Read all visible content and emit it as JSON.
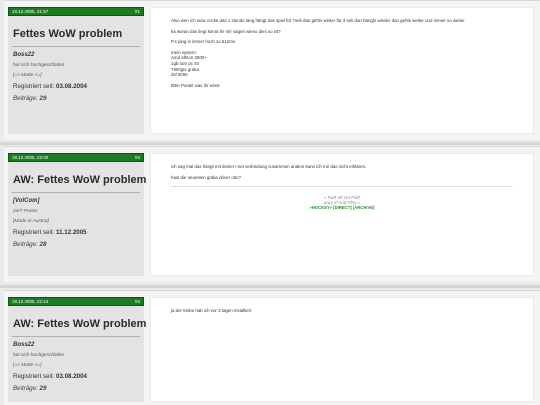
{
  "posts": [
    {
      "date": "19.12.2005, 21:57",
      "number": "#1",
      "title": "Fettes WoW problem",
      "user": "Boss22",
      "user_title": "hat sich hochgeschlafen",
      "extra": "[=> Müde <=]",
      "since_label": "Registriert seit:",
      "since_date": "03.08.2004",
      "count_label": "Beiträge:",
      "count": "29",
      "body": [
        "Also wen ich wow zocke das 1 stunde lang hängt das spiel für 7sek dan gehts weiter für 3 sek dan hängts wieder dan gehts weiter und immer so weiter",
        "ka woran das liegt könnt ihr mir sagen wieso dies so ist?",
        "P.s ping is immer hoch so 612ms",
        "mein system:",
        "Amd athlon 3500+",
        "1gb ram pc 40",
        "7800gtx graka",
        "dsl 6000",
        "Bitte Postet was ihr wisst"
      ]
    },
    {
      "date": "19.12.2005, 22:00",
      "number": "#2",
      "title": "AW: Fettes WoW problem",
      "user": "[VolCom]",
      "user_title": "24/7-Poster",
      "extra": "[Made in Austria]",
      "since_label": "Registriert seit:",
      "since_date": "11.12.2005",
      "count_label": "Beiträge:",
      "count": "28",
      "body": [
        "ich sag mal das hängt mit deiner i-net verbindung zusammen anders kann ich mir das nicht erklären.",
        "hast die neuesten graka driver obn?"
      ],
      "signature": {
        "line1": "« FaiR oR not FaiR",
        "line2": "onLy iF AnD PlAy »",
        "links": "»HOCKEY« [DIRECT] [ARCHIVE]"
      }
    },
    {
      "date": "19.12.2005, 22:14",
      "number": "#3",
      "title": "AW: Fettes WoW problem",
      "user": "Boss22",
      "user_title": "hat sich hochgeschlafen",
      "extra": "[=> Müde <=]",
      "since_label": "Registriert seit:",
      "since_date": "03.08.2004",
      "count_label": "Beiträge:",
      "count": "29",
      "body": [
        "ja der treibe hab ich vor 3 tagen installiert"
      ]
    }
  ]
}
